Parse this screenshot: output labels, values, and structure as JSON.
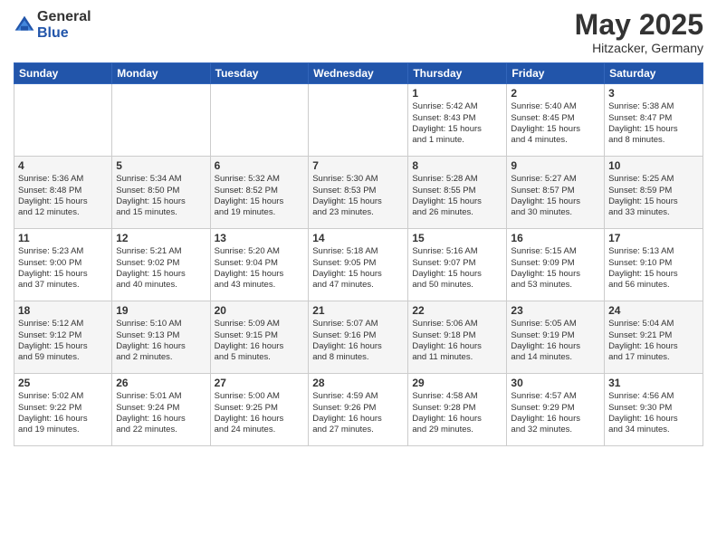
{
  "logo": {
    "general": "General",
    "blue": "Blue"
  },
  "title": "May 2025",
  "subtitle": "Hitzacker, Germany",
  "days_header": [
    "Sunday",
    "Monday",
    "Tuesday",
    "Wednesday",
    "Thursday",
    "Friday",
    "Saturday"
  ],
  "weeks": [
    [
      {
        "day": "",
        "info": ""
      },
      {
        "day": "",
        "info": ""
      },
      {
        "day": "",
        "info": ""
      },
      {
        "day": "",
        "info": ""
      },
      {
        "day": "1",
        "info": "Sunrise: 5:42 AM\nSunset: 8:43 PM\nDaylight: 15 hours\nand 1 minute."
      },
      {
        "day": "2",
        "info": "Sunrise: 5:40 AM\nSunset: 8:45 PM\nDaylight: 15 hours\nand 4 minutes."
      },
      {
        "day": "3",
        "info": "Sunrise: 5:38 AM\nSunset: 8:47 PM\nDaylight: 15 hours\nand 8 minutes."
      }
    ],
    [
      {
        "day": "4",
        "info": "Sunrise: 5:36 AM\nSunset: 8:48 PM\nDaylight: 15 hours\nand 12 minutes."
      },
      {
        "day": "5",
        "info": "Sunrise: 5:34 AM\nSunset: 8:50 PM\nDaylight: 15 hours\nand 15 minutes."
      },
      {
        "day": "6",
        "info": "Sunrise: 5:32 AM\nSunset: 8:52 PM\nDaylight: 15 hours\nand 19 minutes."
      },
      {
        "day": "7",
        "info": "Sunrise: 5:30 AM\nSunset: 8:53 PM\nDaylight: 15 hours\nand 23 minutes."
      },
      {
        "day": "8",
        "info": "Sunrise: 5:28 AM\nSunset: 8:55 PM\nDaylight: 15 hours\nand 26 minutes."
      },
      {
        "day": "9",
        "info": "Sunrise: 5:27 AM\nSunset: 8:57 PM\nDaylight: 15 hours\nand 30 minutes."
      },
      {
        "day": "10",
        "info": "Sunrise: 5:25 AM\nSunset: 8:59 PM\nDaylight: 15 hours\nand 33 minutes."
      }
    ],
    [
      {
        "day": "11",
        "info": "Sunrise: 5:23 AM\nSunset: 9:00 PM\nDaylight: 15 hours\nand 37 minutes."
      },
      {
        "day": "12",
        "info": "Sunrise: 5:21 AM\nSunset: 9:02 PM\nDaylight: 15 hours\nand 40 minutes."
      },
      {
        "day": "13",
        "info": "Sunrise: 5:20 AM\nSunset: 9:04 PM\nDaylight: 15 hours\nand 43 minutes."
      },
      {
        "day": "14",
        "info": "Sunrise: 5:18 AM\nSunset: 9:05 PM\nDaylight: 15 hours\nand 47 minutes."
      },
      {
        "day": "15",
        "info": "Sunrise: 5:16 AM\nSunset: 9:07 PM\nDaylight: 15 hours\nand 50 minutes."
      },
      {
        "day": "16",
        "info": "Sunrise: 5:15 AM\nSunset: 9:09 PM\nDaylight: 15 hours\nand 53 minutes."
      },
      {
        "day": "17",
        "info": "Sunrise: 5:13 AM\nSunset: 9:10 PM\nDaylight: 15 hours\nand 56 minutes."
      }
    ],
    [
      {
        "day": "18",
        "info": "Sunrise: 5:12 AM\nSunset: 9:12 PM\nDaylight: 15 hours\nand 59 minutes."
      },
      {
        "day": "19",
        "info": "Sunrise: 5:10 AM\nSunset: 9:13 PM\nDaylight: 16 hours\nand 2 minutes."
      },
      {
        "day": "20",
        "info": "Sunrise: 5:09 AM\nSunset: 9:15 PM\nDaylight: 16 hours\nand 5 minutes."
      },
      {
        "day": "21",
        "info": "Sunrise: 5:07 AM\nSunset: 9:16 PM\nDaylight: 16 hours\nand 8 minutes."
      },
      {
        "day": "22",
        "info": "Sunrise: 5:06 AM\nSunset: 9:18 PM\nDaylight: 16 hours\nand 11 minutes."
      },
      {
        "day": "23",
        "info": "Sunrise: 5:05 AM\nSunset: 9:19 PM\nDaylight: 16 hours\nand 14 minutes."
      },
      {
        "day": "24",
        "info": "Sunrise: 5:04 AM\nSunset: 9:21 PM\nDaylight: 16 hours\nand 17 minutes."
      }
    ],
    [
      {
        "day": "25",
        "info": "Sunrise: 5:02 AM\nSunset: 9:22 PM\nDaylight: 16 hours\nand 19 minutes."
      },
      {
        "day": "26",
        "info": "Sunrise: 5:01 AM\nSunset: 9:24 PM\nDaylight: 16 hours\nand 22 minutes."
      },
      {
        "day": "27",
        "info": "Sunrise: 5:00 AM\nSunset: 9:25 PM\nDaylight: 16 hours\nand 24 minutes."
      },
      {
        "day": "28",
        "info": "Sunrise: 4:59 AM\nSunset: 9:26 PM\nDaylight: 16 hours\nand 27 minutes."
      },
      {
        "day": "29",
        "info": "Sunrise: 4:58 AM\nSunset: 9:28 PM\nDaylight: 16 hours\nand 29 minutes."
      },
      {
        "day": "30",
        "info": "Sunrise: 4:57 AM\nSunset: 9:29 PM\nDaylight: 16 hours\nand 32 minutes."
      },
      {
        "day": "31",
        "info": "Sunrise: 4:56 AM\nSunset: 9:30 PM\nDaylight: 16 hours\nand 34 minutes."
      }
    ]
  ]
}
